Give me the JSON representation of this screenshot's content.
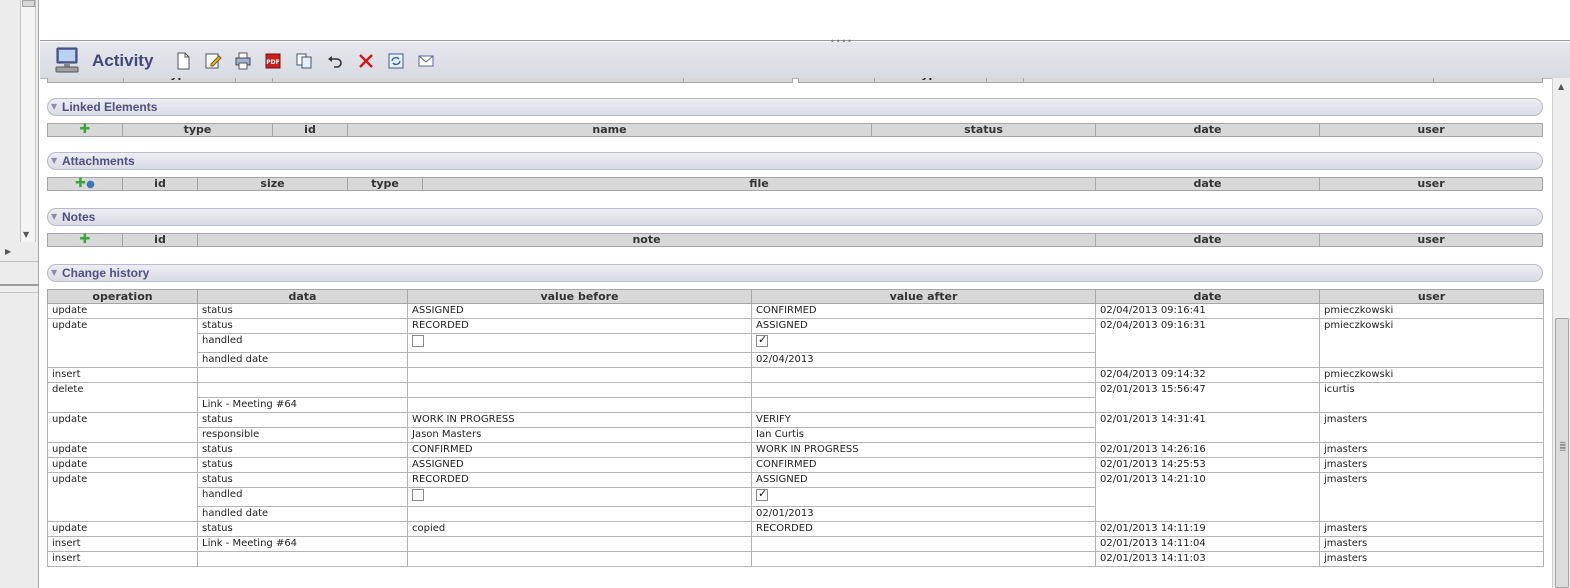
{
  "toolbar": {
    "title": "Activity",
    "icons": [
      "activity-icon",
      "new-icon",
      "edit-icon",
      "print-icon",
      "pdf-icon",
      "copy-icon",
      "undo-icon",
      "delete-icon",
      "refresh-icon",
      "mail-icon"
    ]
  },
  "partial_header": {
    "left": [
      "",
      "type",
      "id",
      "name",
      "status"
    ],
    "right": [
      "",
      "type",
      "id",
      "name",
      "status"
    ]
  },
  "linked_elements": {
    "title": "Linked Elements",
    "columns": [
      "",
      "type",
      "id",
      "name",
      "status",
      "date",
      "user"
    ]
  },
  "attachments": {
    "title": "Attachments",
    "columns": [
      "",
      "id",
      "size",
      "type",
      "file",
      "date",
      "user"
    ]
  },
  "notes": {
    "title": "Notes",
    "columns": [
      "",
      "id",
      "note",
      "date",
      "user"
    ]
  },
  "change_history": {
    "title": "Change history",
    "columns": [
      "operation",
      "data",
      "value before",
      "value after",
      "date",
      "user"
    ],
    "groups": [
      {
        "operation": "update",
        "date": "02/04/2013 09:16:41",
        "user": "pmieczkowski",
        "rows": [
          {
            "data": "status",
            "before": "ASSIGNED",
            "after": "CONFIRMED"
          }
        ]
      },
      {
        "operation": "update",
        "date": "02/04/2013 09:16:31",
        "user": "pmieczkowski",
        "rows": [
          {
            "data": "status",
            "before": "RECORDED",
            "after": "ASSIGNED"
          },
          {
            "data": "handled",
            "before_checkbox": false,
            "after_checkbox": true
          },
          {
            "data": "handled date",
            "before": "",
            "after": "02/04/2013"
          }
        ]
      },
      {
        "operation": "insert",
        "date": "02/04/2013 09:14:32",
        "user": "pmieczkowski",
        "rows": [
          {
            "data": "",
            "before": "",
            "after": ""
          }
        ]
      },
      {
        "operation": "delete",
        "date": "02/01/2013 15:56:47",
        "user": "icurtis",
        "rows": [
          {
            "data": "",
            "before": "",
            "after": ""
          },
          {
            "data": "Link - Meeting #64",
            "before": "",
            "after": ""
          }
        ]
      },
      {
        "operation": "update",
        "date": "02/01/2013 14:31:41",
        "user": "jmasters",
        "rows": [
          {
            "data": "status",
            "before": "WORK IN PROGRESS",
            "after": "VERIFY"
          },
          {
            "data": "responsible",
            "before": "Jason Masters",
            "after": "Ian Curtis"
          }
        ]
      },
      {
        "operation": "update",
        "date": "02/01/2013 14:26:16",
        "user": "jmasters",
        "rows": [
          {
            "data": "status",
            "before": "CONFIRMED",
            "after": "WORK IN PROGRESS"
          }
        ]
      },
      {
        "operation": "update",
        "date": "02/01/2013 14:25:53",
        "user": "jmasters",
        "rows": [
          {
            "data": "status",
            "before": "ASSIGNED",
            "after": "CONFIRMED"
          }
        ]
      },
      {
        "operation": "update",
        "date": "02/01/2013 14:21:10",
        "user": "jmasters",
        "rows": [
          {
            "data": "status",
            "before": "RECORDED",
            "after": "ASSIGNED"
          },
          {
            "data": "handled",
            "before_checkbox": false,
            "after_checkbox": true
          },
          {
            "data": "handled date",
            "before": "",
            "after": "02/01/2013"
          }
        ]
      },
      {
        "operation": "update",
        "date": "02/01/2013 14:11:19",
        "user": "jmasters",
        "rows": [
          {
            "data": "status",
            "before": "copied",
            "after": "RECORDED"
          }
        ]
      },
      {
        "operation": "insert",
        "date": "02/01/2013 14:11:04",
        "user": "jmasters",
        "rows": [
          {
            "data": "Link - Meeting #64",
            "before": "",
            "after": ""
          }
        ]
      },
      {
        "operation": "insert",
        "date": "02/01/2013 14:11:03",
        "user": "jmasters",
        "rows": [
          {
            "data": "",
            "before": "",
            "after": ""
          }
        ]
      }
    ]
  }
}
